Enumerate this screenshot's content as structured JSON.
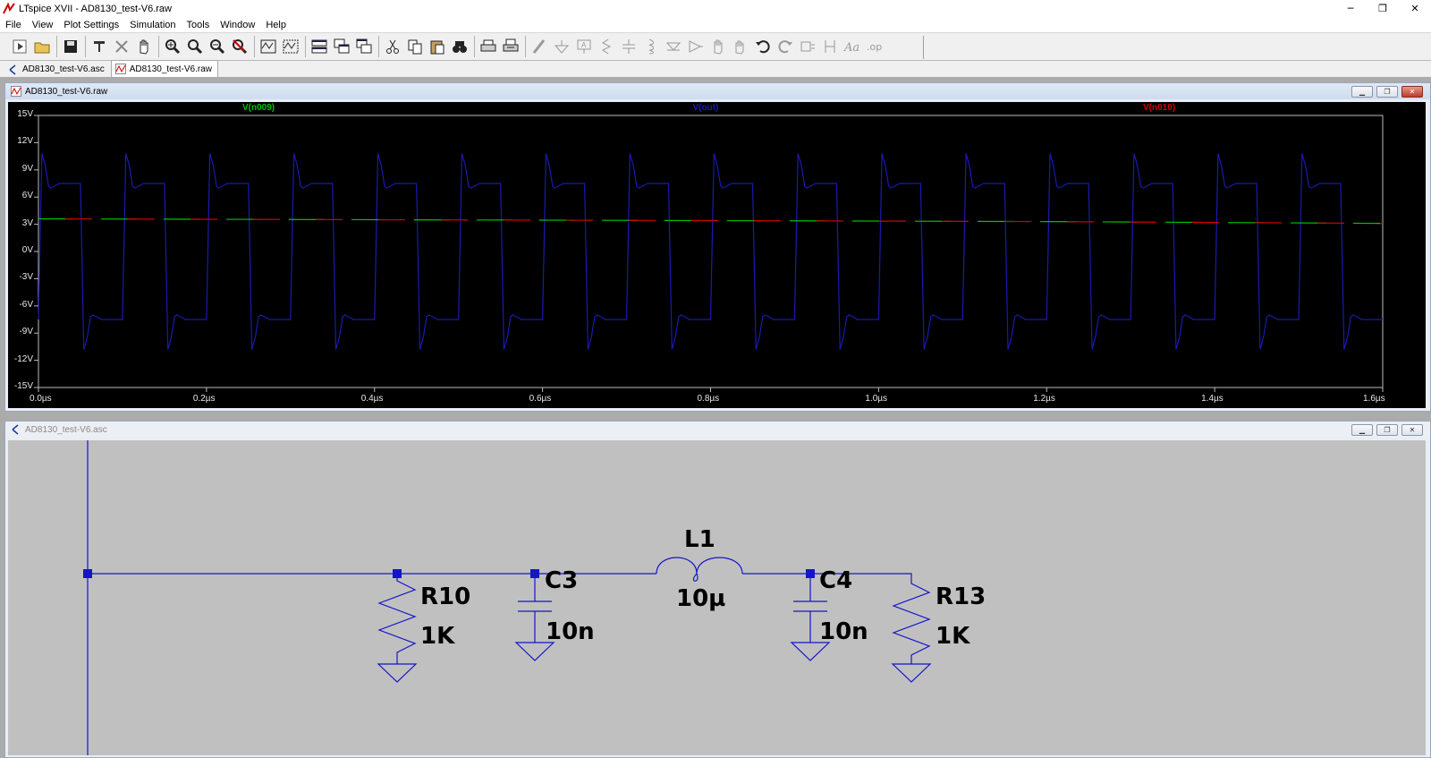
{
  "app": {
    "title": "LTspice XVII - AD8130_test-V6.raw",
    "controls": {
      "minimize": "─",
      "restore": "❐",
      "close": "✕"
    }
  },
  "menu": [
    "File",
    "View",
    "Plot Settings",
    "Simulation",
    "Tools",
    "Window",
    "Help"
  ],
  "toolbar": {
    "icons": [
      "run-icon",
      "open-icon",
      "save-icon",
      "control-panel-icon",
      "halt-icon",
      "pan-icon",
      "zoom-in-icon",
      "zoom-area-icon",
      "zoom-out-icon",
      "zoom-cancel-icon",
      "autorange-icon",
      "manual-limits-icon",
      "tile-horizontal-icon",
      "cascade-icon",
      "tile-vertical-icon",
      "cut-icon",
      "copy-icon",
      "paste-icon",
      "find-icon",
      "print-icon",
      "print-preview-icon",
      "wire-icon",
      "ground-icon",
      "label-icon",
      "resistor-icon",
      "capacitor-icon",
      "inductor-icon",
      "diode-icon",
      "component-icon",
      "move-icon",
      "drag-icon",
      "undo-icon",
      "redo-icon",
      "rotate-icon",
      "mirror-icon",
      "text-icon",
      "spice-directive-icon"
    ]
  },
  "tabs": [
    {
      "label": "AD8130_test-V6.asc",
      "active": false
    },
    {
      "label": "AD8130_test-V6.raw",
      "active": true
    }
  ],
  "plot_window": {
    "title": "AD8130_test-V6.raw"
  },
  "schematic_window": {
    "title": "AD8130_test-V6.asc",
    "components": [
      {
        "ref": "R10",
        "value": "1K"
      },
      {
        "ref": "C3",
        "value": "10n"
      },
      {
        "ref": "L1",
        "value": "10µ"
      },
      {
        "ref": "C4",
        "value": "10n"
      },
      {
        "ref": "R13",
        "value": "1K"
      }
    ]
  },
  "chart_data": {
    "type": "line",
    "title": "",
    "xlabel": "",
    "ylabel": "",
    "xlim": [
      0,
      1.6
    ],
    "ylim": [
      -15,
      15
    ],
    "x_ticks": [
      "0.0µs",
      "0.2µs",
      "0.4µs",
      "0.6µs",
      "0.8µs",
      "1.0µs",
      "1.2µs",
      "1.4µs",
      "1.6µs"
    ],
    "y_ticks": [
      "15V",
      "12V",
      "9V",
      "6V",
      "3V",
      "0V",
      "-3V",
      "-6V",
      "-9V",
      "-12V",
      "-15V"
    ],
    "grid": false,
    "background": "#000000",
    "series": [
      {
        "name": "V(n009)",
        "color": "#00c000",
        "x": [
          0,
          0.4,
          0.8,
          1.2,
          1.6
        ],
        "y": [
          3.6,
          3.5,
          3.4,
          3.3,
          3.1
        ]
      },
      {
        "name": "V(out)",
        "color": "#1a1ab0",
        "period_us": 0.1,
        "high_plateau": 7.5,
        "low_plateau": -7.5,
        "overshoot_peak": 10.8,
        "undershoot_peak": -10.8,
        "x": [
          0,
          0.005,
          0.015,
          0.03,
          0.05,
          0.055,
          0.065,
          0.08,
          0.1
        ],
        "y": [
          -7.5,
          10.8,
          7.2,
          7.5,
          7.5,
          -10.8,
          -7.2,
          -7.5,
          -7.5
        ]
      },
      {
        "name": "V(n010)",
        "color": "#d00000",
        "x": [
          0,
          0.4,
          0.8,
          1.2,
          1.6
        ],
        "y": [
          3.6,
          3.5,
          3.4,
          3.3,
          3.1
        ]
      }
    ]
  }
}
